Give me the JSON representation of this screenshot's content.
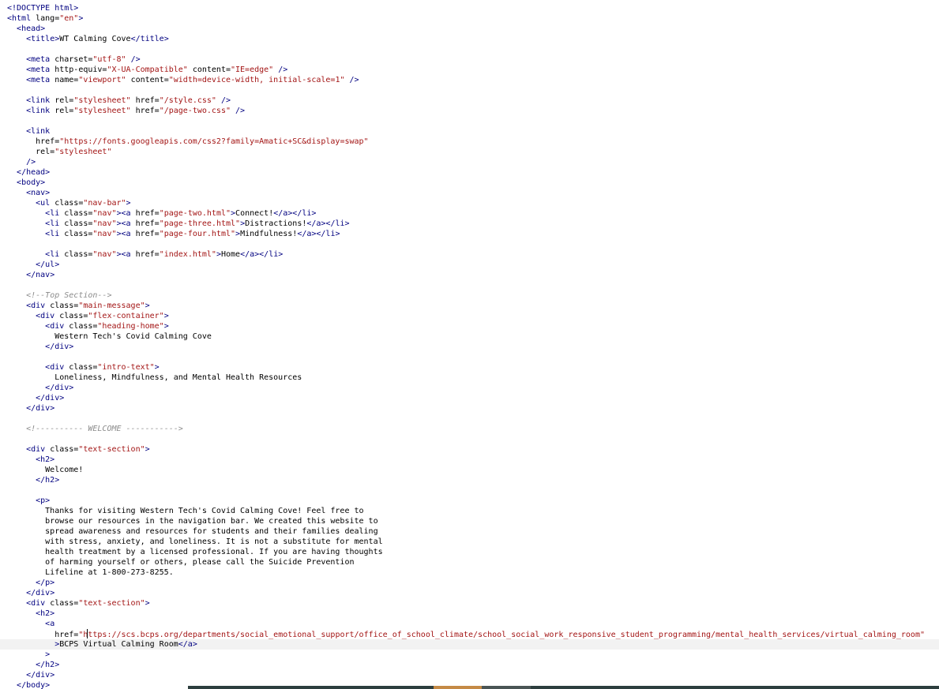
{
  "editor": {
    "language": "html",
    "cursor_line": 62,
    "lines": [
      {
        "t": [
          [
            "tag",
            "<!DOCTYPE html>"
          ]
        ]
      },
      {
        "t": [
          [
            "tag",
            "<html "
          ],
          [
            "attr",
            "lang="
          ],
          [
            "str",
            "\"en\""
          ],
          [
            "tag",
            ">"
          ]
        ]
      },
      {
        "t": [
          [
            "txt",
            "  "
          ],
          [
            "tag",
            "<head>"
          ]
        ]
      },
      {
        "t": [
          [
            "txt",
            "    "
          ],
          [
            "tag",
            "<title>"
          ],
          [
            "txt",
            "WT Calming Cove"
          ],
          [
            "tag",
            "</title>"
          ]
        ]
      },
      {
        "t": []
      },
      {
        "t": [
          [
            "txt",
            "    "
          ],
          [
            "tag",
            "<meta "
          ],
          [
            "attr",
            "charset="
          ],
          [
            "str",
            "\"utf-8\""
          ],
          [
            "tag",
            " />"
          ]
        ]
      },
      {
        "t": [
          [
            "txt",
            "    "
          ],
          [
            "tag",
            "<meta "
          ],
          [
            "attr",
            "http-equiv="
          ],
          [
            "str",
            "\"X-UA-Compatible\""
          ],
          [
            "attr",
            " content="
          ],
          [
            "str",
            "\"IE=edge\""
          ],
          [
            "tag",
            " />"
          ]
        ]
      },
      {
        "t": [
          [
            "txt",
            "    "
          ],
          [
            "tag",
            "<meta "
          ],
          [
            "attr",
            "name="
          ],
          [
            "str",
            "\"viewport\""
          ],
          [
            "attr",
            " content="
          ],
          [
            "str",
            "\"width=device-width, initial-scale=1\""
          ],
          [
            "tag",
            " />"
          ]
        ]
      },
      {
        "t": []
      },
      {
        "t": [
          [
            "txt",
            "    "
          ],
          [
            "tag",
            "<link "
          ],
          [
            "attr",
            "rel="
          ],
          [
            "str",
            "\"stylesheet\""
          ],
          [
            "attr",
            " href="
          ],
          [
            "str",
            "\"/style.css\""
          ],
          [
            "tag",
            " />"
          ]
        ]
      },
      {
        "t": [
          [
            "txt",
            "    "
          ],
          [
            "tag",
            "<link "
          ],
          [
            "attr",
            "rel="
          ],
          [
            "str",
            "\"stylesheet\""
          ],
          [
            "attr",
            " href="
          ],
          [
            "str",
            "\"/page-two.css\""
          ],
          [
            "tag",
            " />"
          ]
        ]
      },
      {
        "t": []
      },
      {
        "t": [
          [
            "txt",
            "    "
          ],
          [
            "tag",
            "<link"
          ]
        ]
      },
      {
        "t": [
          [
            "txt",
            "      "
          ],
          [
            "attr",
            "href="
          ],
          [
            "str",
            "\"https://fonts.googleapis.com/css2?family=Amatic+SC&display=swap\""
          ]
        ]
      },
      {
        "t": [
          [
            "txt",
            "      "
          ],
          [
            "attr",
            "rel="
          ],
          [
            "str",
            "\"stylesheet\""
          ]
        ]
      },
      {
        "t": [
          [
            "txt",
            "    "
          ],
          [
            "tag",
            "/>"
          ]
        ]
      },
      {
        "t": [
          [
            "txt",
            "  "
          ],
          [
            "tag",
            "</head>"
          ]
        ]
      },
      {
        "t": [
          [
            "txt",
            "  "
          ],
          [
            "tag",
            "<body>"
          ]
        ]
      },
      {
        "t": [
          [
            "txt",
            "    "
          ],
          [
            "tag",
            "<nav>"
          ]
        ]
      },
      {
        "t": [
          [
            "txt",
            "      "
          ],
          [
            "tag",
            "<ul "
          ],
          [
            "attr",
            "class="
          ],
          [
            "str",
            "\"nav-bar\""
          ],
          [
            "tag",
            ">"
          ]
        ]
      },
      {
        "t": [
          [
            "txt",
            "        "
          ],
          [
            "tag",
            "<li "
          ],
          [
            "attr",
            "class="
          ],
          [
            "str",
            "\"nav\""
          ],
          [
            "tag",
            "><a "
          ],
          [
            "attr",
            "href="
          ],
          [
            "str",
            "\"page-two.html\""
          ],
          [
            "tag",
            ">"
          ],
          [
            "txt",
            "Connect!"
          ],
          [
            "tag",
            "</a></li>"
          ]
        ]
      },
      {
        "t": [
          [
            "txt",
            "        "
          ],
          [
            "tag",
            "<li "
          ],
          [
            "attr",
            "class="
          ],
          [
            "str",
            "\"nav\""
          ],
          [
            "tag",
            "><a "
          ],
          [
            "attr",
            "href="
          ],
          [
            "str",
            "\"page-three.html\""
          ],
          [
            "tag",
            ">"
          ],
          [
            "txt",
            "Distractions!"
          ],
          [
            "tag",
            "</a></li>"
          ]
        ]
      },
      {
        "t": [
          [
            "txt",
            "        "
          ],
          [
            "tag",
            "<li "
          ],
          [
            "attr",
            "class="
          ],
          [
            "str",
            "\"nav\""
          ],
          [
            "tag",
            "><a "
          ],
          [
            "attr",
            "href="
          ],
          [
            "str",
            "\"page-four.html\""
          ],
          [
            "tag",
            ">"
          ],
          [
            "txt",
            "Mindfulness!"
          ],
          [
            "tag",
            "</a></li>"
          ]
        ]
      },
      {
        "t": []
      },
      {
        "t": [
          [
            "txt",
            "        "
          ],
          [
            "tag",
            "<li "
          ],
          [
            "attr",
            "class="
          ],
          [
            "str",
            "\"nav\""
          ],
          [
            "tag",
            "><a "
          ],
          [
            "attr",
            "href="
          ],
          [
            "str",
            "\"index.html\""
          ],
          [
            "tag",
            ">"
          ],
          [
            "txt",
            "Home"
          ],
          [
            "tag",
            "</a></li>"
          ]
        ]
      },
      {
        "t": [
          [
            "txt",
            "      "
          ],
          [
            "tag",
            "</ul>"
          ]
        ]
      },
      {
        "t": [
          [
            "txt",
            "    "
          ],
          [
            "tag",
            "</nav>"
          ]
        ]
      },
      {
        "t": []
      },
      {
        "t": [
          [
            "txt",
            "    "
          ],
          [
            "cmt",
            "<!--Top Section-->"
          ]
        ]
      },
      {
        "t": [
          [
            "txt",
            "    "
          ],
          [
            "tag",
            "<div "
          ],
          [
            "attr",
            "class="
          ],
          [
            "str",
            "\"main-message\""
          ],
          [
            "tag",
            ">"
          ]
        ]
      },
      {
        "t": [
          [
            "txt",
            "      "
          ],
          [
            "tag",
            "<div "
          ],
          [
            "attr",
            "class="
          ],
          [
            "str",
            "\"flex-container\""
          ],
          [
            "tag",
            ">"
          ]
        ]
      },
      {
        "t": [
          [
            "txt",
            "        "
          ],
          [
            "tag",
            "<div "
          ],
          [
            "attr",
            "class="
          ],
          [
            "str",
            "\"heading-home\""
          ],
          [
            "tag",
            ">"
          ]
        ]
      },
      {
        "t": [
          [
            "txt",
            "          Western Tech's Covid Calming Cove"
          ]
        ]
      },
      {
        "t": [
          [
            "txt",
            "        "
          ],
          [
            "tag",
            "</div>"
          ]
        ]
      },
      {
        "t": []
      },
      {
        "t": [
          [
            "txt",
            "        "
          ],
          [
            "tag",
            "<div "
          ],
          [
            "attr",
            "class="
          ],
          [
            "str",
            "\"intro-text\""
          ],
          [
            "tag",
            ">"
          ]
        ]
      },
      {
        "t": [
          [
            "txt",
            "          Loneliness, Mindfulness, and Mental Health Resources"
          ]
        ]
      },
      {
        "t": [
          [
            "txt",
            "        "
          ],
          [
            "tag",
            "</div>"
          ]
        ]
      },
      {
        "t": [
          [
            "txt",
            "      "
          ],
          [
            "tag",
            "</div>"
          ]
        ]
      },
      {
        "t": [
          [
            "txt",
            "    "
          ],
          [
            "tag",
            "</div>"
          ]
        ]
      },
      {
        "t": []
      },
      {
        "t": [
          [
            "txt",
            "    "
          ],
          [
            "cmt",
            "<!---------- WELCOME ----------->"
          ]
        ]
      },
      {
        "t": []
      },
      {
        "t": [
          [
            "txt",
            "    "
          ],
          [
            "tag",
            "<div "
          ],
          [
            "attr",
            "class="
          ],
          [
            "str",
            "\"text-section\""
          ],
          [
            "tag",
            ">"
          ]
        ]
      },
      {
        "t": [
          [
            "txt",
            "      "
          ],
          [
            "tag",
            "<h2>"
          ]
        ]
      },
      {
        "t": [
          [
            "txt",
            "        Welcome!"
          ]
        ]
      },
      {
        "t": [
          [
            "txt",
            "      "
          ],
          [
            "tag",
            "</h2>"
          ]
        ]
      },
      {
        "t": []
      },
      {
        "t": [
          [
            "txt",
            "      "
          ],
          [
            "tag",
            "<p>"
          ]
        ]
      },
      {
        "t": [
          [
            "txt",
            "        Thanks for visiting Western Tech's Covid Calming Cove! Feel free to"
          ]
        ]
      },
      {
        "t": [
          [
            "txt",
            "        browse our resources in the navigation bar. We created this website to"
          ]
        ]
      },
      {
        "t": [
          [
            "txt",
            "        spread awareness and resources for students and their families dealing"
          ]
        ]
      },
      {
        "t": [
          [
            "txt",
            "        with stress, anxiety, and loneliness. It is not a substitute for mental"
          ]
        ]
      },
      {
        "t": [
          [
            "txt",
            "        health treatment by a licensed professional. If you are having thoughts"
          ]
        ]
      },
      {
        "t": [
          [
            "txt",
            "        of harming yourself or others, please call the Suicide Prevention"
          ]
        ]
      },
      {
        "t": [
          [
            "txt",
            "        Lifeline at 1-800-273-8255."
          ]
        ]
      },
      {
        "t": [
          [
            "txt",
            "      "
          ],
          [
            "tag",
            "</p>"
          ]
        ]
      },
      {
        "t": [
          [
            "txt",
            "    "
          ],
          [
            "tag",
            "</div>"
          ]
        ]
      },
      {
        "t": [
          [
            "txt",
            "    "
          ],
          [
            "tag",
            "<div "
          ],
          [
            "attr",
            "class="
          ],
          [
            "str",
            "\"text-section\""
          ],
          [
            "tag",
            ">"
          ]
        ]
      },
      {
        "t": [
          [
            "txt",
            "      "
          ],
          [
            "tag",
            "<h2>"
          ]
        ]
      },
      {
        "t": [
          [
            "txt",
            "        "
          ],
          [
            "tag",
            "<a"
          ]
        ]
      },
      {
        "t": [
          [
            "txt",
            "          "
          ],
          [
            "attr",
            "href="
          ],
          [
            "str",
            "\"h"
          ],
          [
            "caret",
            ""
          ],
          [
            "str",
            "ttps://scs.bcps.org/departments/social_emotional_support/office_of_school_climate/school_social_work_responsive_student_programming/mental_health_services/virtual_calming_room\""
          ]
        ]
      },
      {
        "t": [
          [
            "txt",
            "          "
          ],
          [
            "tag",
            ">"
          ],
          [
            "txt",
            "BCPS Virtual Calming Room"
          ],
          [
            "tag",
            "</a>"
          ]
        ]
      },
      {
        "t": [
          [
            "txt",
            "        "
          ],
          [
            "tag",
            ">"
          ]
        ]
      },
      {
        "t": [
          [
            "txt",
            "      "
          ],
          [
            "tag",
            "</h2>"
          ]
        ]
      },
      {
        "t": [
          [
            "txt",
            "    "
          ],
          [
            "tag",
            "</div>"
          ]
        ]
      },
      {
        "t": [
          [
            "txt",
            "  "
          ],
          [
            "tag",
            "</body>"
          ]
        ]
      }
    ]
  },
  "statusbar": {
    "segments": [
      {
        "color": "#ffffff"
      },
      {
        "color": "#2d3e3e"
      },
      {
        "color": "#c58a46"
      },
      {
        "color": "#4a5555"
      },
      {
        "color": "#2d3e3e"
      }
    ]
  }
}
